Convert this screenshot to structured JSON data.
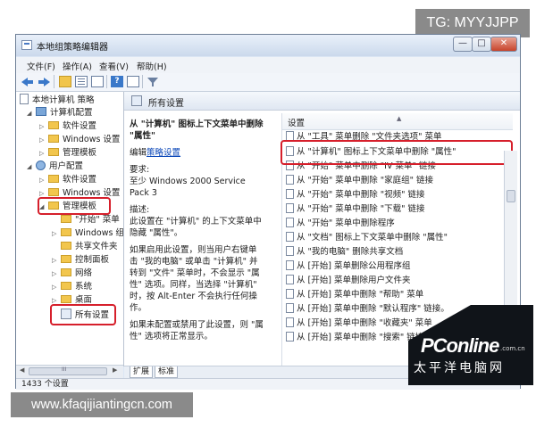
{
  "badges": {
    "telegram": "TG: MYYJJPP",
    "website": "www.kfaqijiantingcn.com"
  },
  "window": {
    "title": "本地组策略编辑器",
    "controls": {
      "minimize": "—",
      "maximize": "□",
      "close": "✕"
    }
  },
  "menubar": {
    "items": [
      "文件(F)",
      "操作(A)",
      "查看(V)",
      "帮助(H)"
    ]
  },
  "toolbar": {
    "help_label": "?"
  },
  "tree": {
    "items": [
      {
        "label": "本地计算机 策略",
        "expander": ""
      },
      {
        "label": "计算机配置",
        "expander": "◢"
      },
      {
        "label": "软件设置",
        "expander": "▷"
      },
      {
        "label": "Windows 设置",
        "expander": "▷"
      },
      {
        "label": "管理模板",
        "expander": "▷"
      },
      {
        "label": "用户配置",
        "expander": "◢"
      },
      {
        "label": "软件设置",
        "expander": "▷"
      },
      {
        "label": "Windows 设置",
        "expander": "▷"
      },
      {
        "label": "管理模板",
        "expander": "◢"
      },
      {
        "label": "\"开始\" 菜单",
        "expander": ""
      },
      {
        "label": "Windows 组",
        "expander": "▷"
      },
      {
        "label": "共享文件夹",
        "expander": ""
      },
      {
        "label": "控制面板",
        "expander": "▷"
      },
      {
        "label": "网络",
        "expander": "▷"
      },
      {
        "label": "系统",
        "expander": "▷"
      },
      {
        "label": "桌面",
        "expander": "▷"
      },
      {
        "label": "所有设置",
        "expander": ""
      }
    ],
    "scroll": {
      "left": "◀",
      "dots": "III",
      "right": "▶"
    }
  },
  "right_header": {
    "title": "所有设置"
  },
  "description": {
    "title": "从 \"计算机\" 图标上下文菜单中删除 \"属性\"",
    "edit_prefix": "编辑",
    "edit_link": "策略设置",
    "requirements_label": "要求:",
    "requirements_value": "至少 Windows 2000 Service Pack 3",
    "desc_label": "描述:",
    "desc_text": "此设置在 \"计算机\" 的上下文菜单中隐藏 \"属性\"。",
    "enabled_text": "如果启用此设置，则当用户右键单击 \"我的电脑\" 或单击 \"计算机\" 并转到 \"文件\" 菜单时，不会显示 \"属性\" 选项。同样，当选择 \"计算机\" 时，按 Alt-Enter 不会执行任何操作。",
    "disabled_text": "如果未配置或禁用了此设置，则 \"属性\" 选项将正常显示。"
  },
  "list": {
    "header": "设置",
    "sort_arrow": "▲",
    "rows": [
      "从 \"工具\" 菜单删除 \"文件夹选项\" 菜单",
      "从 \"计算机\" 图标上下文菜单中删除 \"属性\"",
      "从 \"开始\" 菜单中删除 \"IV 菜单\" 链接",
      "从 \"开始\" 菜单中删除 \"家庭组\" 链接",
      "从 \"开始\" 菜单中删除 \"视频\" 链接",
      "从 \"开始\" 菜单中删除 \"下载\" 链接",
      "从 \"开始\" 菜单中删除程序",
      "从 \"文档\" 图标上下文菜单中删除 \"属性\"",
      "从 \"我的电脑\" 删除共享文档",
      "从 [开始] 菜单删除公用程序组",
      "从 [开始] 菜单删除用户文件夹",
      "从 [开始] 菜单中删除 \"帮助\" 菜单",
      "从 [开始] 菜单中删除 \"默认程序\" 链接。",
      "从 [开始] 菜单中删除 \"收藏夹\" 菜单",
      "从 [开始] 菜单中删除 \"搜索\" 链接"
    ]
  },
  "tabs": {
    "items": [
      "扩展",
      "标准"
    ]
  },
  "status": {
    "text": "1433 个设置"
  },
  "watermark": {
    "logo": "PConline",
    "domain": ".com.cn",
    "subtitle": "太平洋电脑网"
  }
}
